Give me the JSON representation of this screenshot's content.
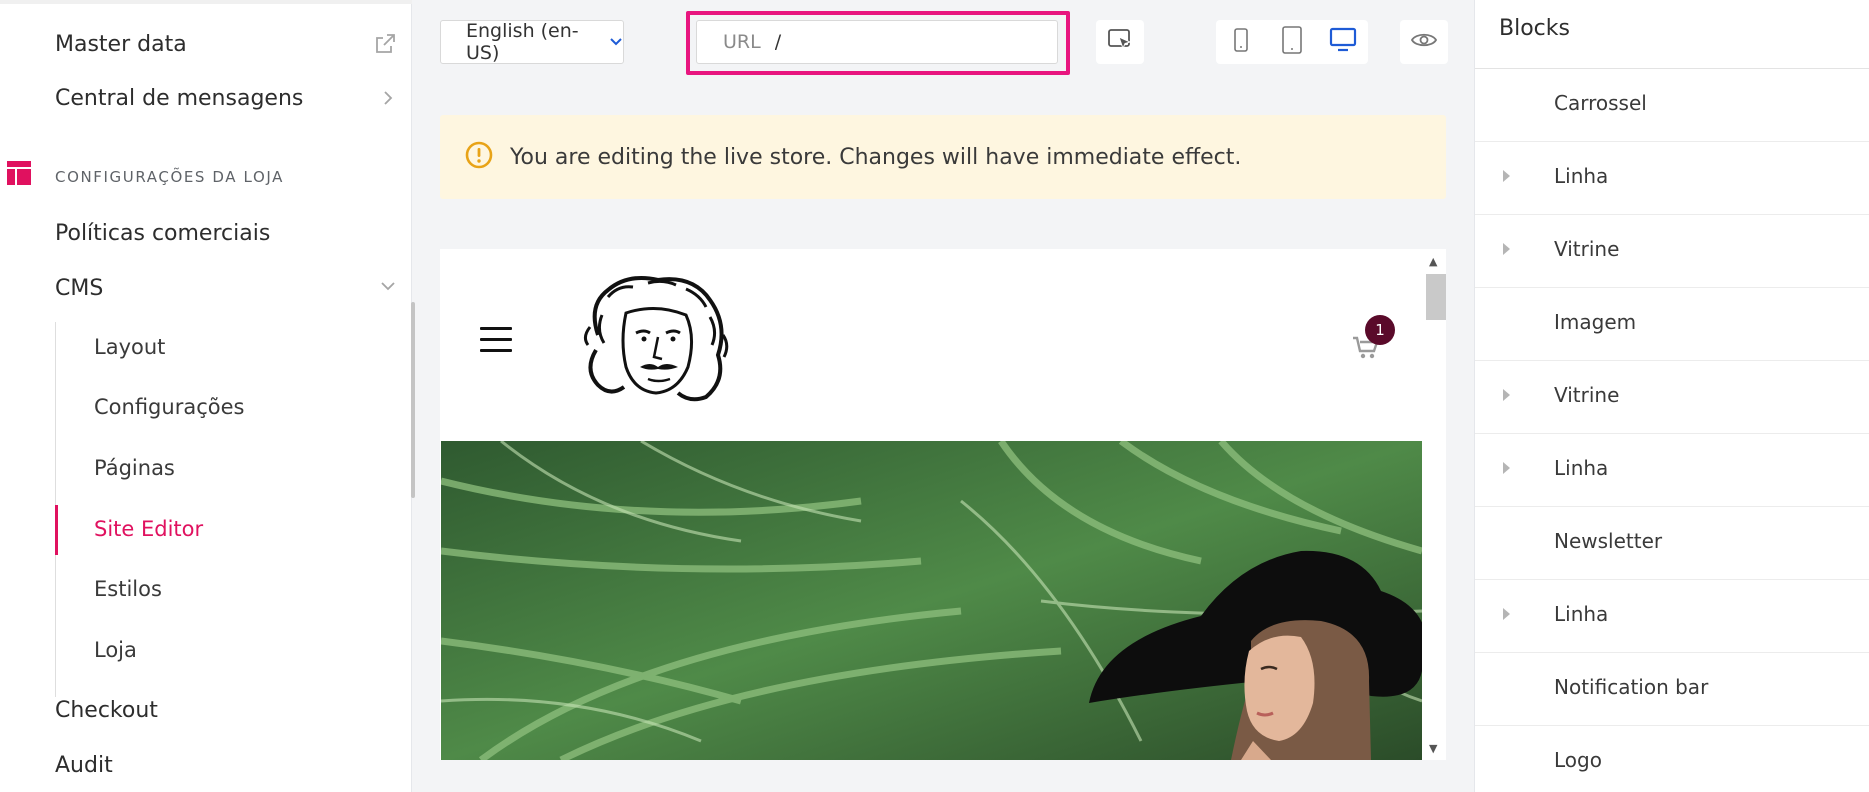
{
  "sidebar": {
    "master_data": "Master data",
    "central_mensagens": "Central de mensagens",
    "section_title": "CONFIGURAÇÕES DA LOJA",
    "politicas": "Políticas comerciais",
    "cms": "CMS",
    "cms_items": [
      "Layout",
      "Configurações",
      "Páginas",
      "Site Editor",
      "Estilos",
      "Loja"
    ],
    "active_item": "Site Editor",
    "checkout": "Checkout",
    "audit": "Audit"
  },
  "toolbar": {
    "language": "English (en-US)",
    "url_label": "URL",
    "url_value": "/",
    "devices": [
      "mobile",
      "tablet",
      "desktop"
    ],
    "active_device": "desktop"
  },
  "warning": {
    "message": "You are editing the live store. Changes will have immediate effect."
  },
  "preview": {
    "cart_count": "1"
  },
  "blocks_panel": {
    "title": "Blocks",
    "items": [
      {
        "label": "Carrossel",
        "expandable": false
      },
      {
        "label": "Linha",
        "expandable": true
      },
      {
        "label": "Vitrine",
        "expandable": true
      },
      {
        "label": "Imagem",
        "expandable": false
      },
      {
        "label": "Vitrine",
        "expandable": true
      },
      {
        "label": "Linha",
        "expandable": true
      },
      {
        "label": "Newsletter",
        "expandable": false
      },
      {
        "label": "Linha",
        "expandable": true
      },
      {
        "label": "Notification bar",
        "expandable": false
      },
      {
        "label": "Logo",
        "expandable": false
      }
    ]
  },
  "colors": {
    "accent": "#e0115f",
    "highlight": "#e8157f",
    "device_active": "#1e5bd6",
    "warning_bg": "#fef6e0",
    "warning_icon": "#e8a317",
    "badge": "#5a0a2a"
  }
}
